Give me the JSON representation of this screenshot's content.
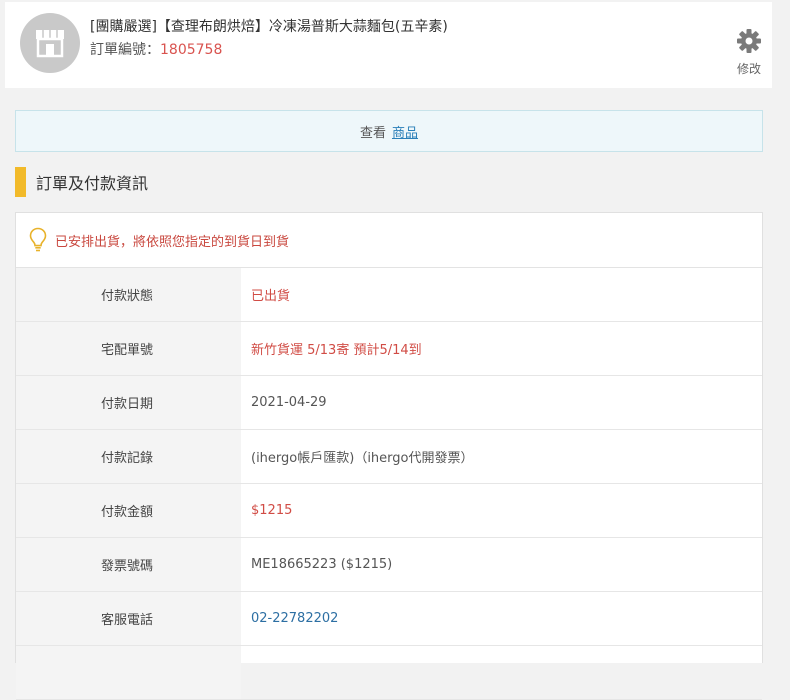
{
  "header": {
    "title": "[團購嚴選]【查理布朗烘焙】冷凍湯普斯大蒜麵包(五辛素)",
    "order_no_label": "訂單編號：",
    "order_no": "1805758",
    "edit_label": "修改"
  },
  "banner": {
    "prefix": "查看",
    "link": "商品"
  },
  "section": {
    "title": "訂單及付款資訊"
  },
  "notice": {
    "text": "已安排出貨，將依照您指定的到貨日到貨"
  },
  "rows": [
    {
      "label": "付款狀態",
      "value": "已出貨"
    },
    {
      "label": "宅配單號",
      "value": "新竹貨運 5/13寄 預計5/14到"
    },
    {
      "label": "付款日期",
      "value": "2021-04-29"
    },
    {
      "label": "付款記錄",
      "value": "(ihergo帳戶匯款)（ihergo代開發票）"
    },
    {
      "label": "付款金額",
      "value": "$1215"
    },
    {
      "label": "發票號碼",
      "value": "ME18665223 ($1215)"
    },
    {
      "label": "客服電話",
      "value": "02-22782202"
    }
  ],
  "colors": {
    "accent_bar": "#f2ba2a",
    "notice_red": "#c9483f",
    "link_blue": "#2d6fa3"
  }
}
